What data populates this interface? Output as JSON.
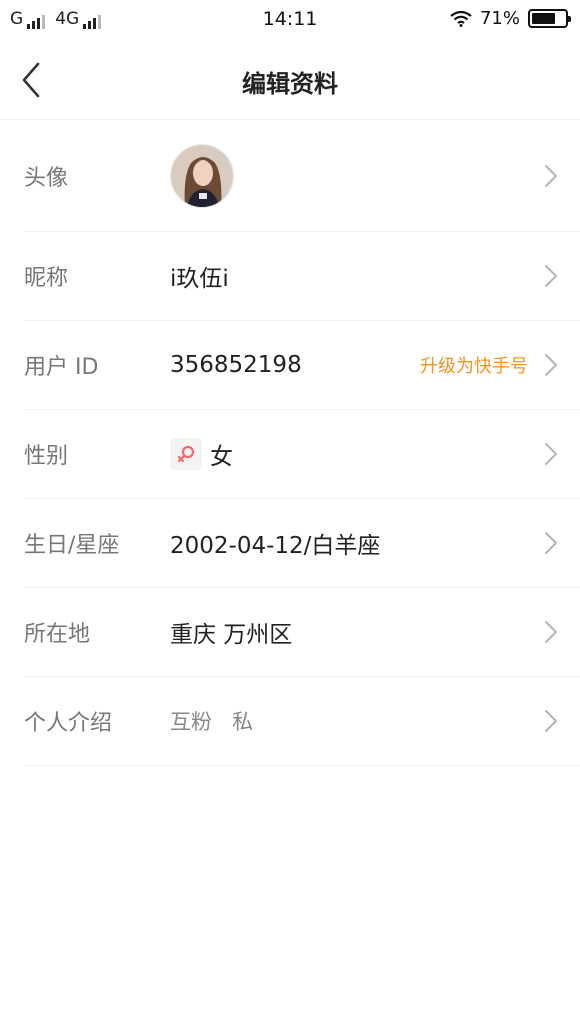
{
  "status_bar": {
    "carrier1": "G",
    "carrier2": "4G",
    "time": "14:11",
    "battery_text": "71%",
    "battery_level": 0.71
  },
  "nav": {
    "back_icon": "chevron-left-icon",
    "title": "编辑资料"
  },
  "profile": {
    "avatar_label": "头像",
    "nickname_label": "昵称",
    "nickname_value": "i玖伍i",
    "user_id_label": "用户 ID",
    "user_id_value": "356852198",
    "user_id_action": "升级为快手号",
    "gender_label": "性别",
    "gender_value": "女",
    "gender_icon": "female-icon",
    "birthday_label": "生日/星座",
    "birthday_value": "2002-04-12/白羊座",
    "location_label": "所在地",
    "location_value": "重庆 万州区",
    "bio_label": "个人介绍",
    "bio_value": "互粉   私"
  },
  "colors": {
    "accent": "#f0951e",
    "label": "#777777",
    "value": "#222222",
    "divider": "#eeeeee",
    "female_icon": "#f26b6b"
  }
}
